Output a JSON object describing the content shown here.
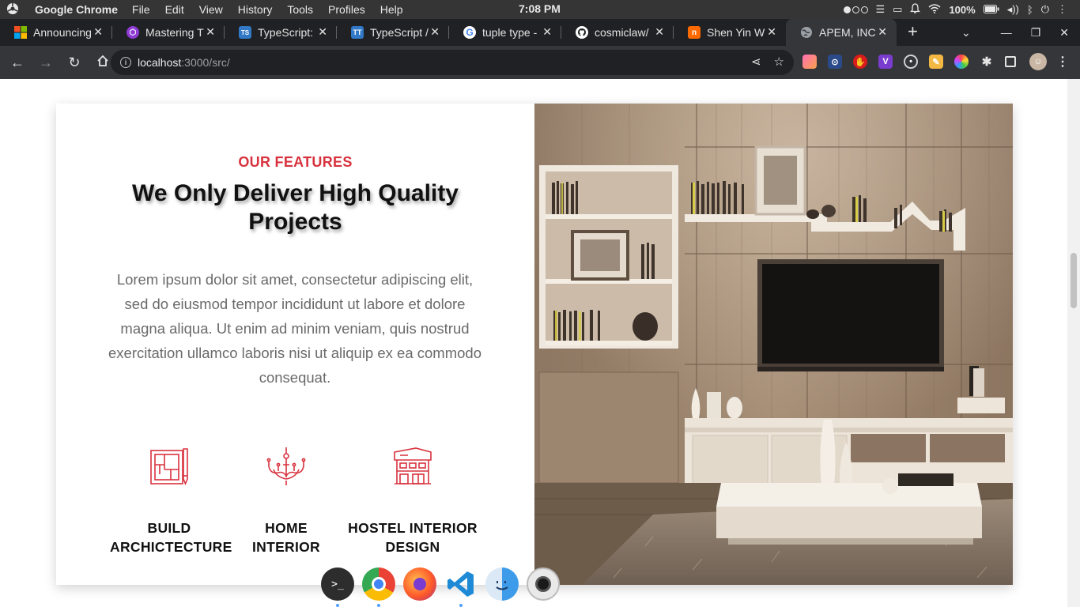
{
  "menubar": {
    "app_name": "Google Chrome",
    "menus": [
      "File",
      "Edit",
      "View",
      "History",
      "Tools",
      "Profiles",
      "Help"
    ],
    "clock": "7:08 PM",
    "battery": "100%"
  },
  "tabs": [
    {
      "title": "Announcing",
      "favicon": "microsoft-icon",
      "color": "#f25022"
    },
    {
      "title": "Mastering T",
      "favicon": "graphql-icon",
      "color": "#8e3bd4"
    },
    {
      "title": "TypeScript:",
      "favicon": "typescript-icon",
      "color": "#3178c6"
    },
    {
      "title": "TypeScript /",
      "favicon": "typescript-tt-icon",
      "color": "#3178c6"
    },
    {
      "title": "tuple type -",
      "favicon": "google-icon",
      "color": "#ffffff"
    },
    {
      "title": "cosmiclaw/",
      "favicon": "github-icon",
      "color": "#ffffff"
    },
    {
      "title": "Shen Yin W",
      "favicon": "novel-icon",
      "color": "#ff6a00"
    },
    {
      "title": "APEM, INC",
      "favicon": "globe-icon",
      "color": "#9aa0a6",
      "active": true
    }
  ],
  "toolbar": {
    "url_host": "localhost",
    "url_path": ":3000/src/"
  },
  "features_section": {
    "eyebrow": "OUR FEATURES",
    "heading": "We Only Deliver High Quality Projects",
    "lead": "Lorem ipsum dolor sit amet, consectetur adipiscing elit, sed do eiusmod tempor incididunt ut labore et dolore magna aliqua. Ut enim ad minim veniam, quis nostrud exercitation ullamco laboris nisi ut aliquip ex ea commodo consequat.",
    "items": [
      {
        "label_line1": "BUILD",
        "label_line2": "ARCHICTECTURE",
        "icon": "blueprint-icon"
      },
      {
        "label_line1": "HOME",
        "label_line2": "INTERIOR",
        "icon": "chandelier-icon"
      },
      {
        "label_line1": "HOSTEL INTERIOR",
        "label_line2": "DESIGN",
        "icon": "building-icon"
      }
    ],
    "accent_color": "#d8323e"
  },
  "dock": {
    "apps": [
      "terminal-icon",
      "chrome-icon",
      "firefox-icon",
      "vscode-icon",
      "finder-icon",
      "camera-icon"
    ]
  }
}
